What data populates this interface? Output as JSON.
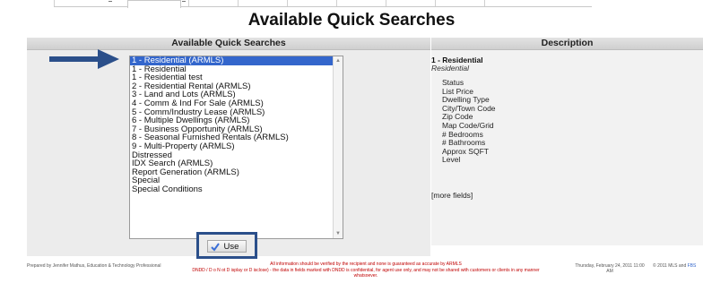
{
  "page_title": "Available Quick Searches",
  "left_panel": {
    "header": "Available Quick Searches",
    "list_items": [
      "1 - Residential (ARMLS)",
      "1 - Residential",
      "1 - Residential test",
      "2 - Residential Rental (ARMLS)",
      "3 - Land and Lots (ARMLS)",
      "4 - Comm & Ind For Sale (ARMLS)",
      "5 - Comm/Industry Lease (ARMLS)",
      "6 - Multiple Dwellings (ARMLS)",
      "7 - Business Opportunity (ARMLS)",
      "8 - Seasonal Furnished Rentals (ARMLS)",
      "9 - Multi-Property (ARMLS)",
      "Distressed",
      "IDX Search (ARMLS)",
      "Report Generation (ARMLS)",
      "Special",
      "Special Conditions"
    ],
    "selected_index": 0,
    "use_label": "Use"
  },
  "right_panel": {
    "header": "Description",
    "title": "1 - Residential",
    "subtitle": "Residential",
    "fields": [
      "Status",
      "List Price",
      "Dwelling Type",
      "City/Town Code",
      "Zip Code",
      "Map Code/Grid",
      "# Bedrooms",
      "# Bathrooms",
      "Approx SQFT",
      "Level"
    ],
    "more": "[more fields]"
  },
  "footer": {
    "left": "Prepared by Jennifer Mathus, Education & Technology Professional",
    "notice": "All information should be verified by the recipient and none is guaranteed as accurate by ARMLS",
    "notice2": "DNDD / D o N ot D isplay or D isclose) - the data in fields marked with DNDD is confidential, for agent use only, and may not be shared with customers or clients in any manner whatsoever.",
    "date": "Thursday, February 24, 2011 11:00 AM",
    "copyright": "© 2011 MLS and",
    "copyright_link": "FBS"
  },
  "colors": {
    "selected_bg": "#3366cc",
    "arrow": "#2b4f8a",
    "panel_bg": "#ececec",
    "notice": "#c00000"
  },
  "icons": {
    "arrow": "right-arrow-icon",
    "use": "checkmark-icon"
  }
}
